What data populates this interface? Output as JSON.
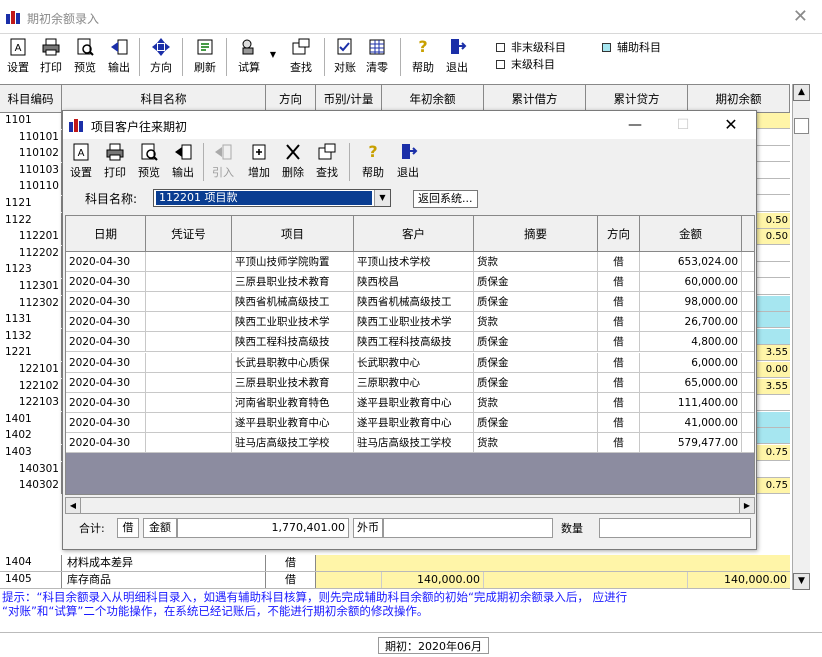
{
  "window": {
    "title": "期初余额录入"
  },
  "toolbar": {
    "buttons": [
      {
        "label": "设置",
        "icon": "settings-icon"
      },
      {
        "label": "打印",
        "icon": "print-icon"
      },
      {
        "label": "预览",
        "icon": "preview-icon"
      },
      {
        "label": "输出",
        "icon": "export-icon"
      },
      {
        "label": "方向",
        "icon": "direction-icon"
      },
      {
        "label": "刷新",
        "icon": "refresh-icon"
      },
      {
        "label": "试算",
        "icon": "trial-balance-icon"
      },
      {
        "label": "查找",
        "icon": "find-icon"
      },
      {
        "label": "对账",
        "icon": "reconcile-icon"
      },
      {
        "label": "清零",
        "icon": "clear-icon"
      },
      {
        "label": "帮助",
        "icon": "help-icon"
      },
      {
        "label": "退出",
        "icon": "exit-icon"
      }
    ],
    "legend": [
      {
        "label": "非末级科目",
        "color": "#ffffff"
      },
      {
        "label": "辅助科目",
        "color": "#a6e6f0"
      },
      {
        "label": "末级科目",
        "color": "#ffffff"
      }
    ]
  },
  "main_grid": {
    "columns": [
      "科目编码",
      "科目名称",
      "方向",
      "币别/计量",
      "年初余额",
      "累计借方",
      "累计贷方",
      "期初余额"
    ],
    "codes": [
      {
        "code": "1101",
        "level": 1
      },
      {
        "code": "110101",
        "level": 2
      },
      {
        "code": "110102",
        "level": 2
      },
      {
        "code": "110103",
        "level": 2
      },
      {
        "code": "110110",
        "level": 2
      },
      {
        "code": "1121",
        "level": 1
      },
      {
        "code": "1122",
        "level": 1
      },
      {
        "code": "112201",
        "level": 2
      },
      {
        "code": "112202",
        "level": 2
      },
      {
        "code": "1123",
        "level": 1
      },
      {
        "code": "112301",
        "level": 2
      },
      {
        "code": "112302",
        "level": 2
      },
      {
        "code": "1131",
        "level": 1
      },
      {
        "code": "1132",
        "level": 1
      },
      {
        "code": "1221",
        "level": 1
      },
      {
        "code": "122101",
        "level": 2
      },
      {
        "code": "122102",
        "level": 2
      },
      {
        "code": "122103",
        "level": 2
      },
      {
        "code": "1401",
        "level": 1
      },
      {
        "code": "1402",
        "level": 1
      },
      {
        "code": "1403",
        "level": 1
      },
      {
        "code": "140301",
        "level": 2
      },
      {
        "code": "140302",
        "level": 2
      }
    ],
    "partial_values": {
      "r1122": "0.50",
      "r112201": "0.50",
      "r1221": "3.55",
      "r122101": "0.00",
      "r122102": "3.55",
      "r1403": "0.75",
      "r140302": "0.75"
    },
    "bottom_rows": [
      {
        "code": "1404",
        "name": "材料成本差异",
        "direction": "借",
        "opening": "",
        "closing": ""
      },
      {
        "code": "1405",
        "name": "库存商品",
        "direction": "借",
        "opening": "140,000.00",
        "closing": "140,000.00"
      }
    ]
  },
  "tip": {
    "line1": "提示：“科目余额录入从明细科目录入，如遇有辅助科目核算，则先完成辅助科目余额的初始“完成期初余额录入后，         应进行",
    "line2": "“对账”和“试算”二个功能操作，在系统已经记账后，不能进行期初余额的修改操作。"
  },
  "status": {
    "period": "期初：2020年06月"
  },
  "dialog": {
    "title": "项目客户往来期初",
    "buttons": [
      {
        "label": "设置",
        "icon": "settings-icon",
        "enabled": true
      },
      {
        "label": "打印",
        "icon": "print-icon",
        "enabled": true
      },
      {
        "label": "预览",
        "icon": "preview-icon",
        "enabled": true
      },
      {
        "label": "输出",
        "icon": "export-icon",
        "enabled": true
      },
      {
        "label": "引入",
        "icon": "import-icon",
        "enabled": false
      },
      {
        "label": "增加",
        "icon": "add-icon",
        "enabled": true
      },
      {
        "label": "删除",
        "icon": "delete-icon",
        "enabled": true
      },
      {
        "label": "查找",
        "icon": "find-icon",
        "enabled": true
      },
      {
        "label": "帮助",
        "icon": "help-icon",
        "enabled": true
      },
      {
        "label": "退出",
        "icon": "exit-icon",
        "enabled": true
      }
    ],
    "subject_label": "科目名称:",
    "subject_value": "112201 项目款",
    "tooltip": "返回系统...",
    "columns": [
      "日期",
      "凭证号",
      "项目",
      "客户",
      "摘要",
      "方向",
      "金额"
    ],
    "rows": [
      {
        "date": "2020-04-30",
        "voucher": "",
        "project": "平顶山技师学院购置",
        "customer": "平顶山技术学校",
        "summary": "货款",
        "direction": "借",
        "amount": "653,024.00"
      },
      {
        "date": "2020-04-30",
        "voucher": "",
        "project": "三原县职业技术教育",
        "customer": "陕西校昌",
        "summary": "质保金",
        "direction": "借",
        "amount": "60,000.00"
      },
      {
        "date": "2020-04-30",
        "voucher": "",
        "project": "陕西省机械高级技工",
        "customer": "陕西省机械高级技工",
        "summary": "质保金",
        "direction": "借",
        "amount": "98,000.00"
      },
      {
        "date": "2020-04-30",
        "voucher": "",
        "project": "陕西工业职业技术学",
        "customer": "陕西工业职业技术学",
        "summary": "货款",
        "direction": "借",
        "amount": "26,700.00"
      },
      {
        "date": "2020-04-30",
        "voucher": "",
        "project": "陕西工程科技高级技",
        "customer": "陕西工程科技高级技",
        "summary": "质保金",
        "direction": "借",
        "amount": "4,800.00"
      },
      {
        "date": "2020-04-30",
        "voucher": "",
        "project": "长武县职教中心质保",
        "customer": "长武职教中心",
        "summary": "质保金",
        "direction": "借",
        "amount": "6,000.00"
      },
      {
        "date": "2020-04-30",
        "voucher": "",
        "project": "三原县职业技术教育",
        "customer": "三原职教中心",
        "summary": "质保金",
        "direction": "借",
        "amount": "65,000.00"
      },
      {
        "date": "2020-04-30",
        "voucher": "",
        "project": "河南省职业教育特色",
        "customer": "遂平县职业教育中心",
        "summary": "货款",
        "direction": "借",
        "amount": "111,400.00"
      },
      {
        "date": "2020-04-30",
        "voucher": "",
        "project": "遂平县职业教育中心",
        "customer": "遂平县职业教育中心",
        "summary": "质保金",
        "direction": "借",
        "amount": "41,000.00"
      },
      {
        "date": "2020-04-30",
        "voucher": "",
        "project": "驻马店高级技工学校",
        "customer": "驻马店高级技工学校",
        "summary": "货款",
        "direction": "借",
        "amount": "579,477.00"
      }
    ],
    "footer": {
      "total_label": "合计:",
      "direction": "借",
      "amount_label": "金额",
      "amount": "1,770,401.00",
      "currency_label": "外币",
      "currency_value": "",
      "quantity_label": "数量",
      "quantity_value": ""
    }
  }
}
